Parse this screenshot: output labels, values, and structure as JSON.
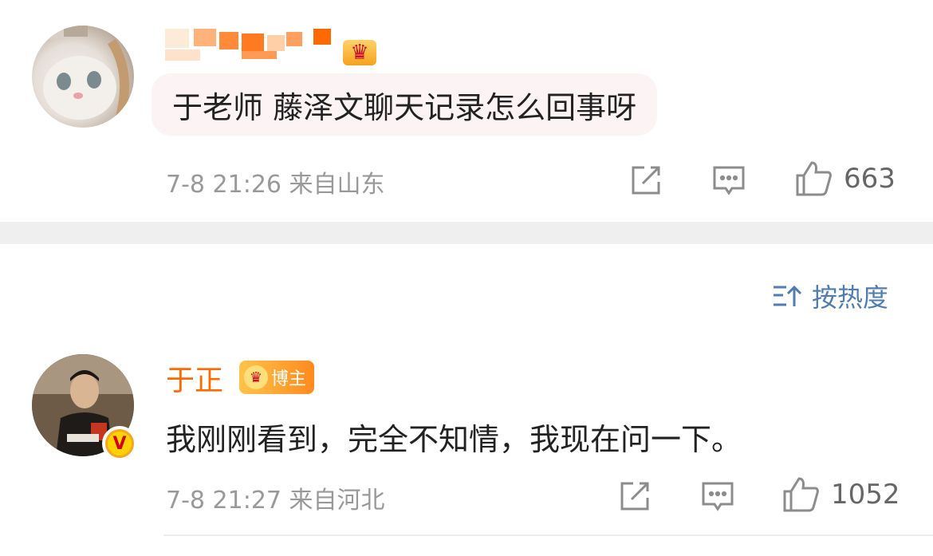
{
  "comments": [
    {
      "username": "",
      "text": "于老师 藤泽文聊天记录怎么回事呀",
      "meta": "7-8 21:26 来自山东",
      "likes": "663",
      "badge_icon": "crown-icon"
    },
    {
      "username": "于正",
      "badge_label": "博主",
      "verified_mark": "V",
      "text": "我刚刚看到，完全不知情，我现在问一下。",
      "meta": "7-8 21:27 来自河北",
      "likes": "1052",
      "badge_icon": "crown-icon"
    }
  ],
  "sort": {
    "label": "按热度",
    "icon": "sort-icon"
  },
  "colors": {
    "username": "#ff6a00",
    "link": "#507daf",
    "meta": "#999999",
    "bubble": "#fcf3f5"
  }
}
